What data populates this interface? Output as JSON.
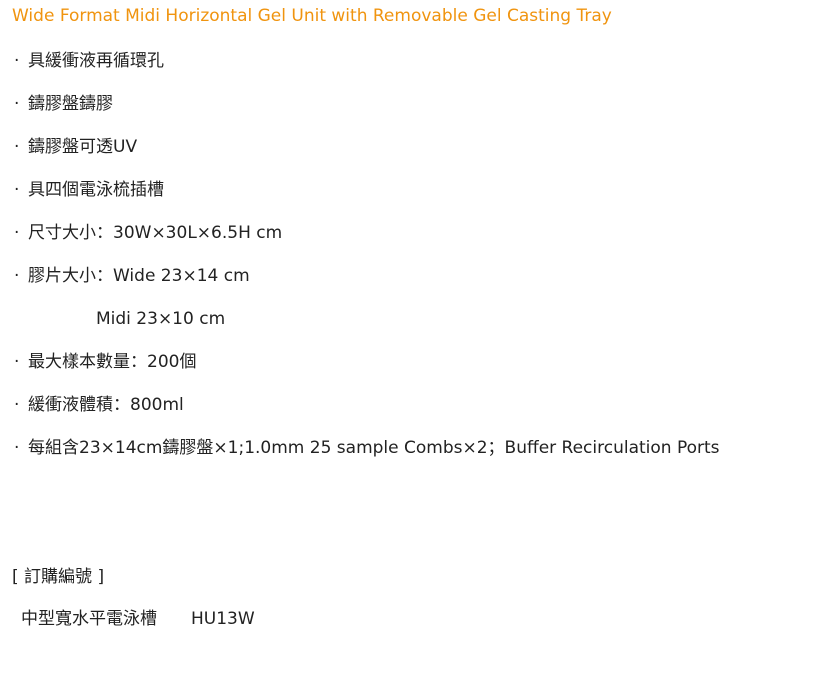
{
  "product": {
    "title": "Wide Format Midi Horizontal Gel Unit with Removable Gel Casting Tray",
    "title_color": "#f0940f"
  },
  "features": {
    "bullet": "·",
    "items": [
      "具緩衝液再循環孔",
      "鑄膠盤鑄膠",
      "鑄膠盤可透UV",
      "具四個電泳梳插槽",
      "尺寸大小：30W×30L×6.5H cm",
      "膠片大小：Wide 23×14 cm",
      "Midi 23×10 cm",
      "最大樣本數量：200個",
      "緩衝液體積：800ml",
      "每組含23×14cm鑄膠盤×1;1.0mm 25 sample Combs×2；Buffer Recirculation Ports"
    ]
  },
  "ordering": {
    "heading": "[ 訂購編號 ]",
    "rows": [
      {
        "name": "中型寬水平電泳槽",
        "code": "HU13W"
      }
    ]
  }
}
